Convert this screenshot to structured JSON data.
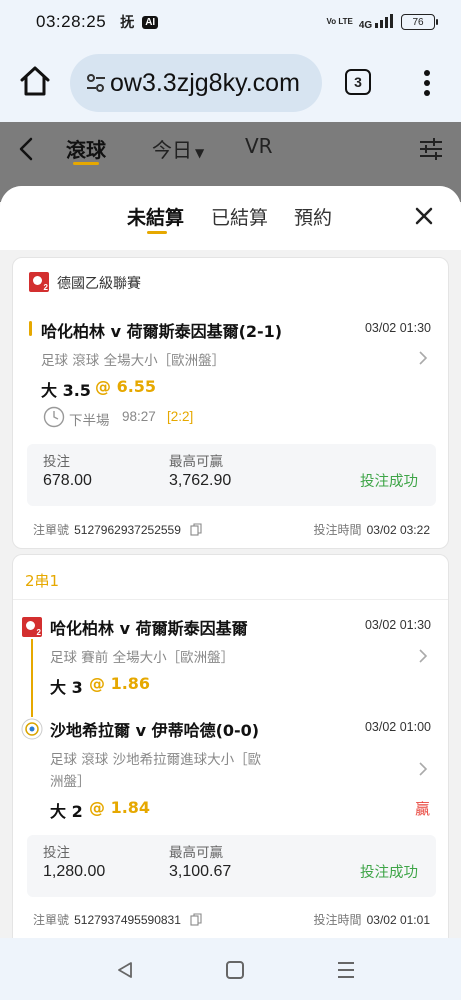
{
  "status_bar": {
    "time": "03:28:25",
    "app_glyph": "抚",
    "ai_badge": "AI",
    "volte": "Vo LTE",
    "signal": "4G",
    "battery": "76"
  },
  "browser": {
    "url": "ow3.3zjg8ky.com",
    "tab_count": "3"
  },
  "app_nav": {
    "tabs": [
      {
        "label": "滾球"
      },
      {
        "label": "今日"
      },
      {
        "label": "VR"
      }
    ]
  },
  "sheet": {
    "tabs": [
      {
        "label": "未結算"
      },
      {
        "label": "已結算"
      },
      {
        "label": "預約"
      }
    ]
  },
  "bets": [
    {
      "league": "德國乙級聯賽",
      "match": "哈化柏林 v 荷爾斯泰因基爾(2-1)",
      "time": "03/02 01:30",
      "meta": "足球  滾球   全場大小［歐洲盤］",
      "pick": "大 3.5",
      "odds": "@ 6.55",
      "period": "下半場",
      "clock": "98:27",
      "score": "[2:2]",
      "stake_label": "投注",
      "stake": "678.00",
      "max_win_label": "最高可贏",
      "max_win": "3,762.90",
      "status": "投注成功",
      "order_label": "注單號",
      "order_no": "5127962937252559",
      "bet_time_label": "投注時間",
      "bet_time": "03/02 03:22"
    },
    {
      "parlay_label": "2串1",
      "legs": [
        {
          "match": "哈化柏林 v 荷爾斯泰因基爾",
          "time": "03/02 01:30",
          "meta": "足球  賽前   全場大小［歐洲盤］",
          "pick": "大 3",
          "odds": "@ 1.86",
          "result": ""
        },
        {
          "match": "沙地希拉爾 v 伊蒂哈德(0-0)",
          "time": "03/02 01:00",
          "meta_line1": "足球  滾球   沙地希拉爾進球大小［歐",
          "meta_line2": "洲盤］",
          "pick": "大 2",
          "odds": "@ 1.84",
          "result": "贏"
        }
      ],
      "stake_label": "投注",
      "stake": "1,280.00",
      "max_win_label": "最高可贏",
      "max_win": "3,100.67",
      "status": "投注成功",
      "order_label": "注單號",
      "order_no": "5127937495590831",
      "bet_time_label": "投注時間",
      "bet_time": "03/02 01:01"
    }
  ],
  "colors": {
    "accent": "#e6a800",
    "success": "#3fa548",
    "win": "#e8453c",
    "league_red": "#d32f2f"
  }
}
